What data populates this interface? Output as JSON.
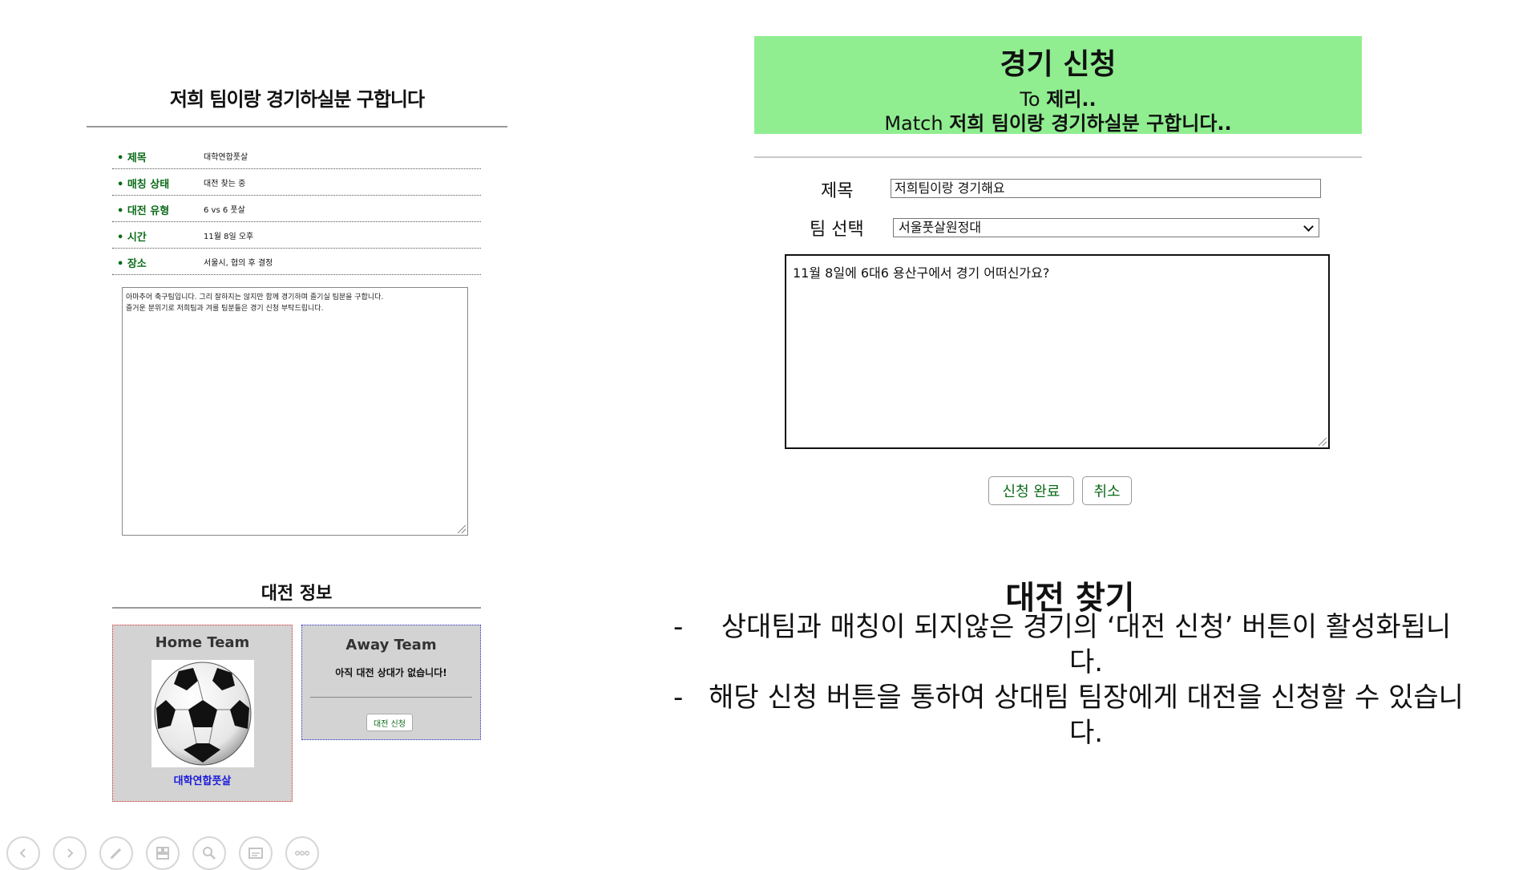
{
  "left_post": {
    "title": "저희 팀이랑 경기하실분 구합니다",
    "rows": [
      {
        "label": "• 제목",
        "value": "대학연합풋살"
      },
      {
        "label": "• 매칭 상태",
        "value": "대전 찾는 중"
      },
      {
        "label": "• 대전 유형",
        "value": "6 vs 6 풋살"
      },
      {
        "label": "• 시간",
        "value": "11월 8일 오후"
      },
      {
        "label": "• 장소",
        "value": "서울시, 협의 후 결정"
      }
    ],
    "body_line1": "아마추어 축구팀입니다. 그리 잘하지는 않지만 함께 경기하며 즐기실 팀분을 구합니다.",
    "body_line2": "즐거운 분위기로 저희팀과 겨룰 팀분들은 경기 신청 부탁드립니다."
  },
  "battle_info": {
    "title": "대전 정보",
    "home_label": "Home Team",
    "home_team_name": "대학연합풋살",
    "away_label": "Away Team",
    "away_message": "아직 대전 상대가 없습니다!",
    "apply_button": "대전 신청"
  },
  "apply_form": {
    "title": "경기 신청",
    "to_prefix": "To",
    "to_name": "제리..",
    "match_prefix": "Match",
    "match_name": "저희 팀이랑 경기하실분 구합니다..",
    "title_label": "제목",
    "title_value": "저희팀이랑 경기해요",
    "team_label": "팀 선택",
    "team_selected": "서울풋살원정대",
    "message": "11월 8일에 6대6 용산구에서 경기 어떠신가요?",
    "submit_label": "신청 완료",
    "cancel_label": "취소",
    "header_color": "#90ee90"
  },
  "description": {
    "title": "대전 찾기",
    "dash": "-",
    "item1": "상대팀과 매칭이 되지않은 경기의 ‘대전 신청’ 버튼이 활성화됩니다.",
    "item2": "해당 신청 버튼을 통하여 상대팀 팀장에게 대전을 신청할 수 있습니다."
  },
  "toolbar": {
    "icons": [
      "prev-icon",
      "next-icon",
      "pen-icon",
      "slides-icon",
      "zoom-icon",
      "subtitle-icon",
      "more-icon"
    ]
  }
}
